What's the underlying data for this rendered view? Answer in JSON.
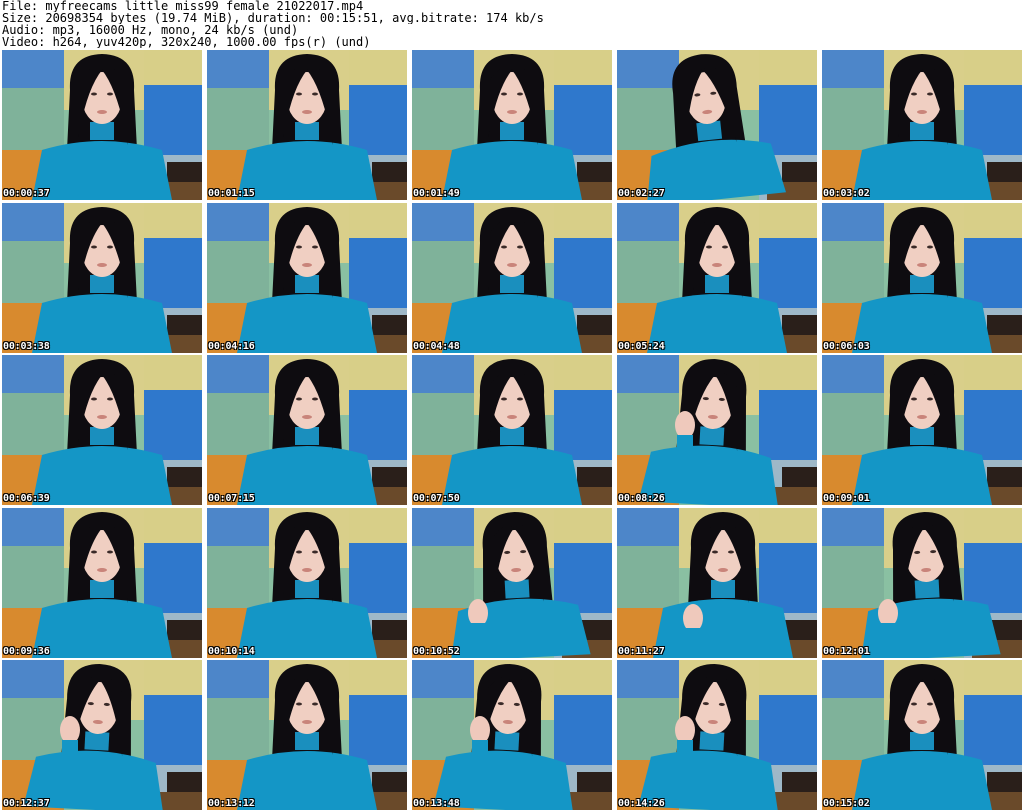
{
  "header": {
    "file_line": "File: myfreecams_little_miss99_female_21022017.mp4",
    "size_line": "Size: 20698354 bytes (19.74 MiB), duration: 00:15:51, avg.bitrate: 174 kb/s",
    "audio_line": "Audio: mp3, 16000 Hz, mono, 24 kb/s (und)",
    "video_line": "Video: h264, yuv420p, 320x240, 1000.00 fps(r) (und)"
  },
  "thumbnails": [
    {
      "timestamp": "00:00:37",
      "pose": "center"
    },
    {
      "timestamp": "00:01:15",
      "pose": "center"
    },
    {
      "timestamp": "00:01:49",
      "pose": "center"
    },
    {
      "timestamp": "00:02:27",
      "pose": "tilt-left"
    },
    {
      "timestamp": "00:03:02",
      "pose": "center"
    },
    {
      "timestamp": "00:03:38",
      "pose": "center"
    },
    {
      "timestamp": "00:04:16",
      "pose": "center"
    },
    {
      "timestamp": "00:04:48",
      "pose": "center"
    },
    {
      "timestamp": "00:05:24",
      "pose": "center"
    },
    {
      "timestamp": "00:06:03",
      "pose": "center"
    },
    {
      "timestamp": "00:06:39",
      "pose": "center"
    },
    {
      "timestamp": "00:07:15",
      "pose": "center"
    },
    {
      "timestamp": "00:07:50",
      "pose": "center"
    },
    {
      "timestamp": "00:08:26",
      "pose": "hand-face"
    },
    {
      "timestamp": "00:09:01",
      "pose": "center"
    },
    {
      "timestamp": "00:09:36",
      "pose": "center"
    },
    {
      "timestamp": "00:10:14",
      "pose": "center"
    },
    {
      "timestamp": "00:10:52",
      "pose": "hand-hair"
    },
    {
      "timestamp": "00:11:27",
      "pose": "hand-point"
    },
    {
      "timestamp": "00:12:01",
      "pose": "hand-hair"
    },
    {
      "timestamp": "00:12:37",
      "pose": "hand-face"
    },
    {
      "timestamp": "00:13:12",
      "pose": "center"
    },
    {
      "timestamp": "00:13:48",
      "pose": "hand-face"
    },
    {
      "timestamp": "00:14:26",
      "pose": "hand-face"
    },
    {
      "timestamp": "00:15:02",
      "pose": "center"
    }
  ]
}
